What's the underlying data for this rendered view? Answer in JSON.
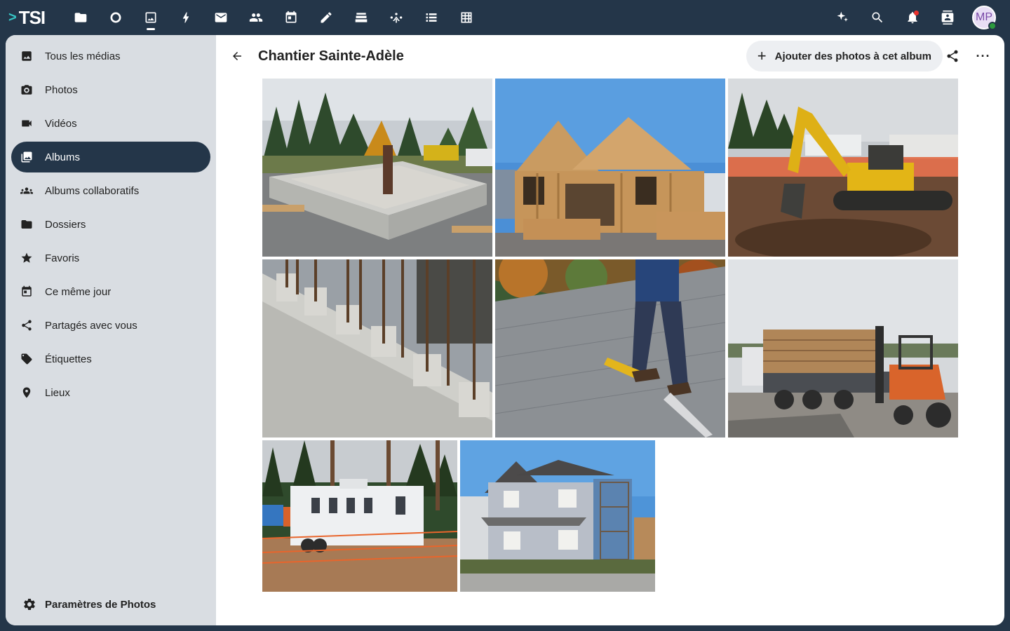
{
  "app": {
    "logo_text": "TSI",
    "logo_chevron": ">"
  },
  "topnav": {
    "apps": [
      {
        "icon": "folder-icon"
      },
      {
        "icon": "circle-icon"
      },
      {
        "icon": "photos-icon",
        "active": true
      },
      {
        "icon": "activity-icon"
      },
      {
        "icon": "mail-icon"
      },
      {
        "icon": "contacts-icon"
      },
      {
        "icon": "calendar-icon"
      },
      {
        "icon": "notes-icon"
      },
      {
        "icon": "deck-icon"
      },
      {
        "icon": "team-icon"
      },
      {
        "icon": "tasks-icon"
      },
      {
        "icon": "tables-icon"
      }
    ],
    "right": [
      "assistant-icon",
      "search-icon",
      "notifications-icon",
      "contacts-menu-icon"
    ],
    "avatar_initials": "MP",
    "colors": {
      "bar": "#243649",
      "accent": "#36c6c6",
      "notification": "#e9322d",
      "online": "#2d9a3e"
    }
  },
  "sidebar": {
    "items": [
      {
        "label": "Tous les médias",
        "icon": "image-icon"
      },
      {
        "label": "Photos",
        "icon": "camera-icon"
      },
      {
        "label": "Vidéos",
        "icon": "video-icon"
      },
      {
        "label": "Albums",
        "icon": "album-icon",
        "active": true
      },
      {
        "label": "Albums collaboratifs",
        "icon": "group-icon"
      },
      {
        "label": "Dossiers",
        "icon": "folder-icon"
      },
      {
        "label": "Favoris",
        "icon": "star-icon"
      },
      {
        "label": "Ce même jour",
        "icon": "calendar-icon"
      },
      {
        "label": "Partagés avec vous",
        "icon": "share-icon"
      },
      {
        "label": "Étiquettes",
        "icon": "tag-icon"
      },
      {
        "label": "Lieux",
        "icon": "pin-icon"
      }
    ],
    "settings_label": "Paramètres de Photos"
  },
  "header": {
    "title": "Chantier Sainte-Adèle",
    "add_label": "Ajouter des photos à cet album",
    "more_label": "···"
  },
  "photos": [
    {
      "subject": "concrete-foundation"
    },
    {
      "subject": "wood-frame-house"
    },
    {
      "subject": "excavator"
    },
    {
      "subject": "concrete-wall-rebar"
    },
    {
      "subject": "roofer-on-shingles"
    },
    {
      "subject": "lumber-truck-forklift"
    },
    {
      "subject": "site-trailer"
    },
    {
      "subject": "finished-house"
    }
  ]
}
